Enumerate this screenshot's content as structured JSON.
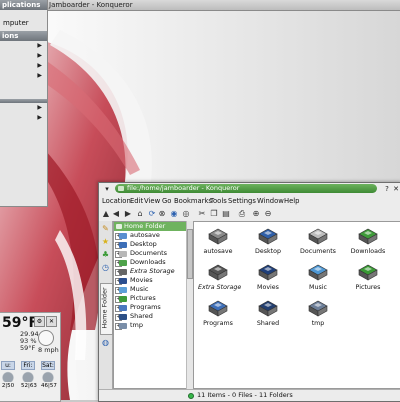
{
  "top_title": "Jamboarder - Konqueror",
  "kmenu": {
    "header_applications": "plications",
    "item_computer": "mputer",
    "header_actions": "ions",
    "arrow_items": 4,
    "bottom_items": 2
  },
  "weather": {
    "temperature": "59°F",
    "line1": "29.94",
    "line2": "93 %",
    "line3": "59°F",
    "wind": "8 mph",
    "days": [
      {
        "name": "u:",
        "temps": "2|50"
      },
      {
        "name": "Fri:",
        "temps": "52|63"
      },
      {
        "name": "Sat:",
        "temps": "46|57"
      }
    ]
  },
  "konqueror": {
    "title": "file:/home/jamboarder - Konqueror",
    "menu": [
      "Location",
      "Edit",
      "View",
      "Go",
      "Bookmarks",
      "Tools",
      "Settings",
      "Window",
      "Help"
    ],
    "home_tab_label": "Home Folder",
    "tree": {
      "root": "Home Folder",
      "items": [
        {
          "label": "autosave",
          "italic": false,
          "color": "#5a8fd0"
        },
        {
          "label": "Desktop",
          "italic": false,
          "color": "#3d6fb8"
        },
        {
          "label": "Documents",
          "italic": false,
          "color": "#b8b8b8"
        },
        {
          "label": "Downloads",
          "italic": false,
          "color": "#4ea24a"
        },
        {
          "label": "Extra Storage",
          "italic": true,
          "color": "#666666"
        },
        {
          "label": "Movies",
          "italic": false,
          "color": "#2b4e8f"
        },
        {
          "label": "Music",
          "italic": false,
          "color": "#5ea0d8"
        },
        {
          "label": "Pictures",
          "italic": false,
          "color": "#3f9b3a"
        },
        {
          "label": "Programs",
          "italic": false,
          "color": "#4a78c0"
        },
        {
          "label": "Shared",
          "italic": false,
          "color": "#2c4f86"
        },
        {
          "label": "tmp",
          "italic": false,
          "color": "#7a8ea8"
        }
      ]
    },
    "files": [
      {
        "label": "autosave",
        "italic": false,
        "icon": "gear-folder-icon",
        "color": "#8a8a8a"
      },
      {
        "label": "Desktop",
        "italic": false,
        "icon": "desktop-folder-icon",
        "color": "#2f5fa8"
      },
      {
        "label": "Documents",
        "italic": false,
        "icon": "documents-folder-icon",
        "color": "#bdbdbd"
      },
      {
        "label": "Downloads",
        "italic": false,
        "icon": "downloads-folder-icon",
        "color": "#3e9b39"
      },
      {
        "label": "Extra Storage",
        "italic": true,
        "icon": "storage-folder-icon",
        "color": "#555555"
      },
      {
        "label": "Movies",
        "italic": false,
        "icon": "movies-folder-icon",
        "color": "#1f3f7a"
      },
      {
        "label": "Music",
        "italic": false,
        "icon": "music-folder-icon",
        "color": "#4f98d4"
      },
      {
        "label": "Pictures",
        "italic": false,
        "icon": "pictures-folder-icon",
        "color": "#3a9a35"
      },
      {
        "label": "Programs",
        "italic": false,
        "icon": "programs-folder-icon",
        "color": "#3e6fb8"
      },
      {
        "label": "Shared",
        "italic": false,
        "icon": "shared-folder-icon",
        "color": "#233f70"
      },
      {
        "label": "tmp",
        "italic": false,
        "icon": "tmp-folder-icon",
        "color": "#6d7f99"
      }
    ],
    "status": "11 Items - 0 Files - 11 Folders"
  },
  "colors": {
    "accent_green": "#4f9d45",
    "wallpaper_red": "#b01e2e"
  }
}
